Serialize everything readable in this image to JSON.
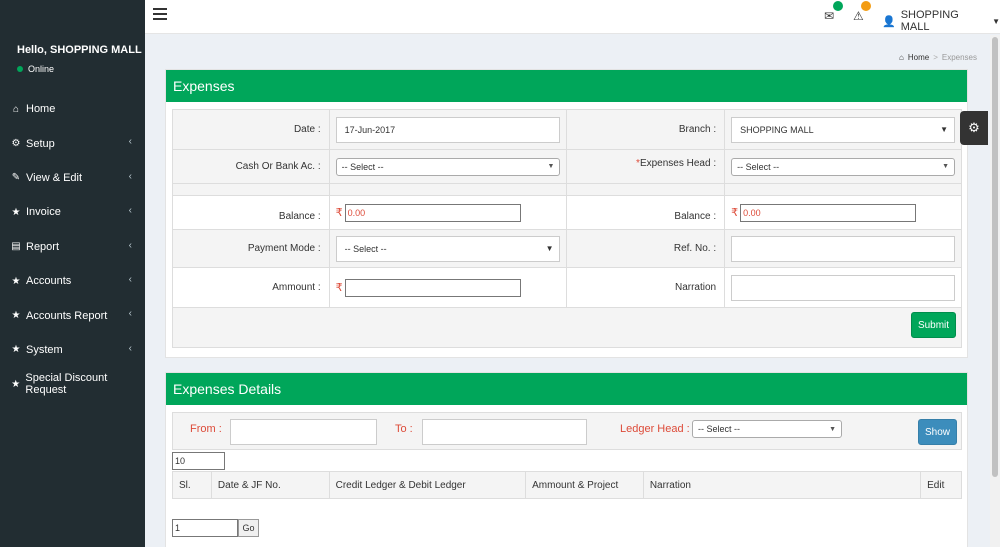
{
  "sidebar": {
    "user_name": "Hello, SHOPPING MALL",
    "status": "Online",
    "items": [
      {
        "label": "Home",
        "icon": "home-icon",
        "glyph": "⌂",
        "has_children": false
      },
      {
        "label": "Setup",
        "icon": "cogs-icon",
        "glyph": "⚙",
        "has_children": true
      },
      {
        "label": "View & Edit",
        "icon": "edit-icon",
        "glyph": "✎",
        "has_children": true
      },
      {
        "label": "Invoice",
        "icon": "star-icon",
        "glyph": "★",
        "has_children": true
      },
      {
        "label": "Report",
        "icon": "file-icon",
        "glyph": "▤",
        "has_children": true
      },
      {
        "label": "Accounts",
        "icon": "star-icon",
        "glyph": "★",
        "has_children": true
      },
      {
        "label": "Accounts Report",
        "icon": "star-icon",
        "glyph": "★",
        "has_children": true
      },
      {
        "label": "System",
        "icon": "star-icon",
        "glyph": "★",
        "has_children": true
      },
      {
        "label": "Special Discount Request",
        "icon": "star-icon",
        "glyph": "★",
        "has_children": false
      }
    ]
  },
  "header": {
    "user_label": "SHOPPING MALL",
    "colors": {
      "mail_badge": "#00a65a",
      "alert_badge": "#f39c12"
    }
  },
  "breadcrumb": {
    "home": "Home",
    "current": "Expenses"
  },
  "expenses": {
    "title": "Expenses",
    "date_label": "Date :",
    "date_value": "17-Jun-2017",
    "branch_label": "Branch :",
    "branch_value": "SHOPPING MALL",
    "cash_label": "Cash Or Bank Ac. :",
    "cash_value": "-- Select --",
    "head_label": "Expenses Head :",
    "head_required": "*",
    "head_value": "-- Select --",
    "balance_label": "Balance :",
    "balance_value": "0.00",
    "balance2_label": "Balance :",
    "balance2_value": "0.00",
    "payment_label": "Payment Mode :",
    "payment_value": "-- Select --",
    "ref_label": "Ref. No. :",
    "amount_label": "Ammount :",
    "narration_label": "Narration",
    "submit_label": "Submit",
    "rupee": "₹"
  },
  "details": {
    "title": "Expenses Details",
    "from_label": "From :",
    "to_label": "To :",
    "ledger_label": "Ledger Head :",
    "ledger_value": "-- Select --",
    "show_label": "Show",
    "page_size": "10",
    "columns": [
      "Sl.",
      "Date & JF No.",
      "Credit Ledger & Debit Ledger",
      "Ammount & Project",
      "Narration",
      "Edit"
    ],
    "page_value": "1",
    "go_label": "Go"
  },
  "colors": {
    "primary": "#00a65a",
    "sidebar": "#222d32",
    "info": "#3c8dbc",
    "danger": "#dd4b39"
  }
}
